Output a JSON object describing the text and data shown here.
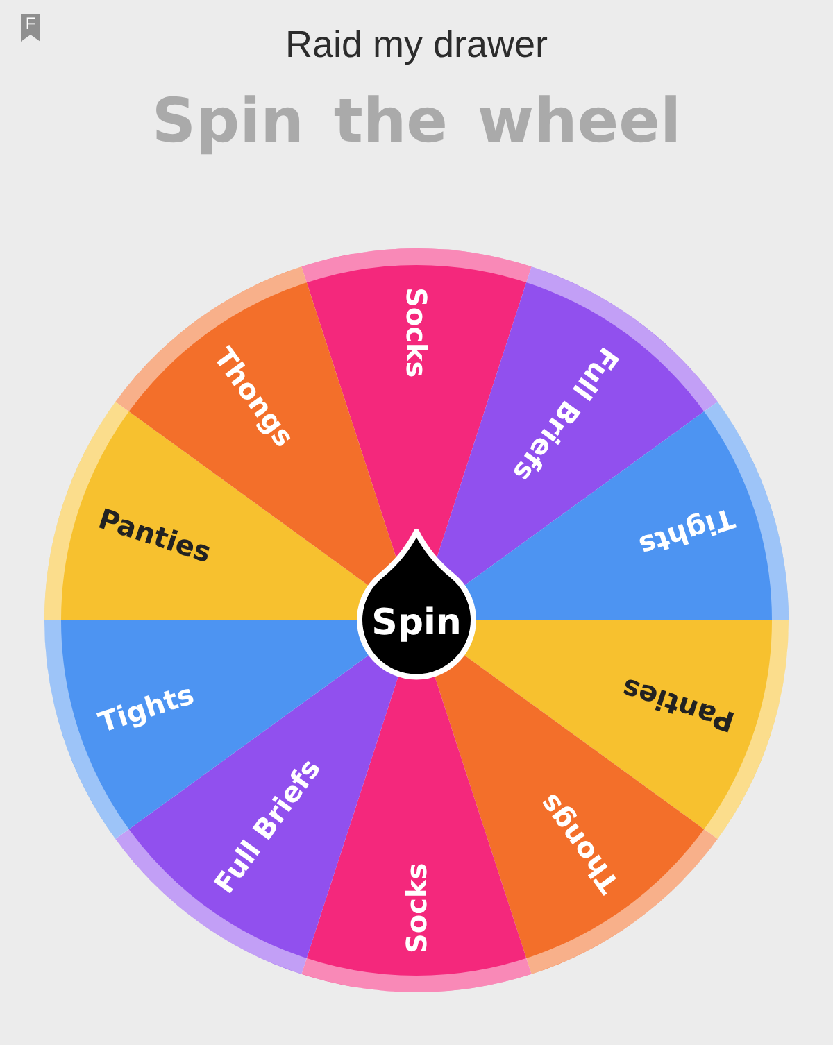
{
  "badge": {
    "letter": "F"
  },
  "header": {
    "title": "Raid my drawer"
  },
  "heading": "Spin the wheel",
  "wheel": {
    "segments": [
      {
        "label": "Socks",
        "color": "#f4287c"
      },
      {
        "label": "Full Briefs",
        "color": "#9150ee"
      },
      {
        "label": "Tights",
        "color": "#4d94f2"
      },
      {
        "label": "Panties",
        "color": "#f7c12f"
      },
      {
        "label": "Thongs",
        "color": "#f36f2a"
      },
      {
        "label": "Socks",
        "color": "#f4287c"
      },
      {
        "label": "Full Briefs",
        "color": "#9150ee"
      },
      {
        "label": "Tights",
        "color": "#4d94f2"
      },
      {
        "label": "Panties",
        "color": "#f7c12f"
      },
      {
        "label": "Thongs",
        "color": "#f36f2a"
      }
    ],
    "button": {
      "label": "Spin"
    }
  }
}
